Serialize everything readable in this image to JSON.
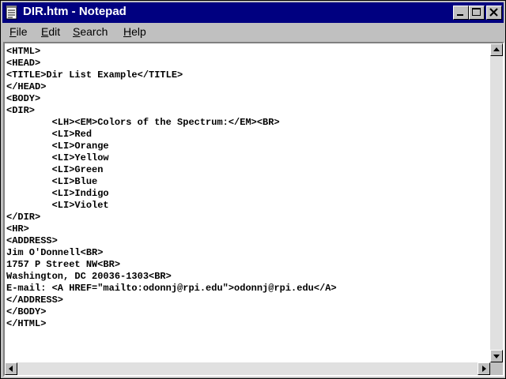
{
  "window": {
    "title": "DIR.htm - Notepad"
  },
  "menu": {
    "items": [
      "File",
      "Edit",
      "Search",
      "Help"
    ]
  },
  "document": {
    "lines": [
      "<HTML>",
      "<HEAD>",
      "<TITLE>Dir List Example</TITLE>",
      "</HEAD>",
      "<BODY>",
      "<DIR>",
      "        <LH><EM>Colors of the Spectrum:</EM><BR>",
      "        <LI>Red",
      "        <LI>Orange",
      "        <LI>Yellow",
      "        <LI>Green",
      "        <LI>Blue",
      "        <LI>Indigo",
      "        <LI>Violet",
      "</DIR>",
      "<HR>",
      "<ADDRESS>",
      "Jim O'Donnell<BR>",
      "1757 P Street NW<BR>",
      "Washington, DC 20036-1303<BR>",
      "E-mail: <A HREF=\"mailto:odonnj@rpi.edu\">odonnj@rpi.edu</A>",
      "</ADDRESS>",
      "</BODY>",
      "</HTML>"
    ]
  },
  "icons": {
    "app": "notepad-icon",
    "minimize": "minimize-icon",
    "maximize": "maximize-icon",
    "close": "close-icon",
    "scroll_up": "arrow-up-icon",
    "scroll_down": "arrow-down-icon",
    "scroll_left": "arrow-left-icon",
    "scroll_right": "arrow-right-icon"
  },
  "colors": {
    "titlebar": "#000080",
    "face": "#c0c0c0",
    "editor_bg": "#ffffff"
  }
}
